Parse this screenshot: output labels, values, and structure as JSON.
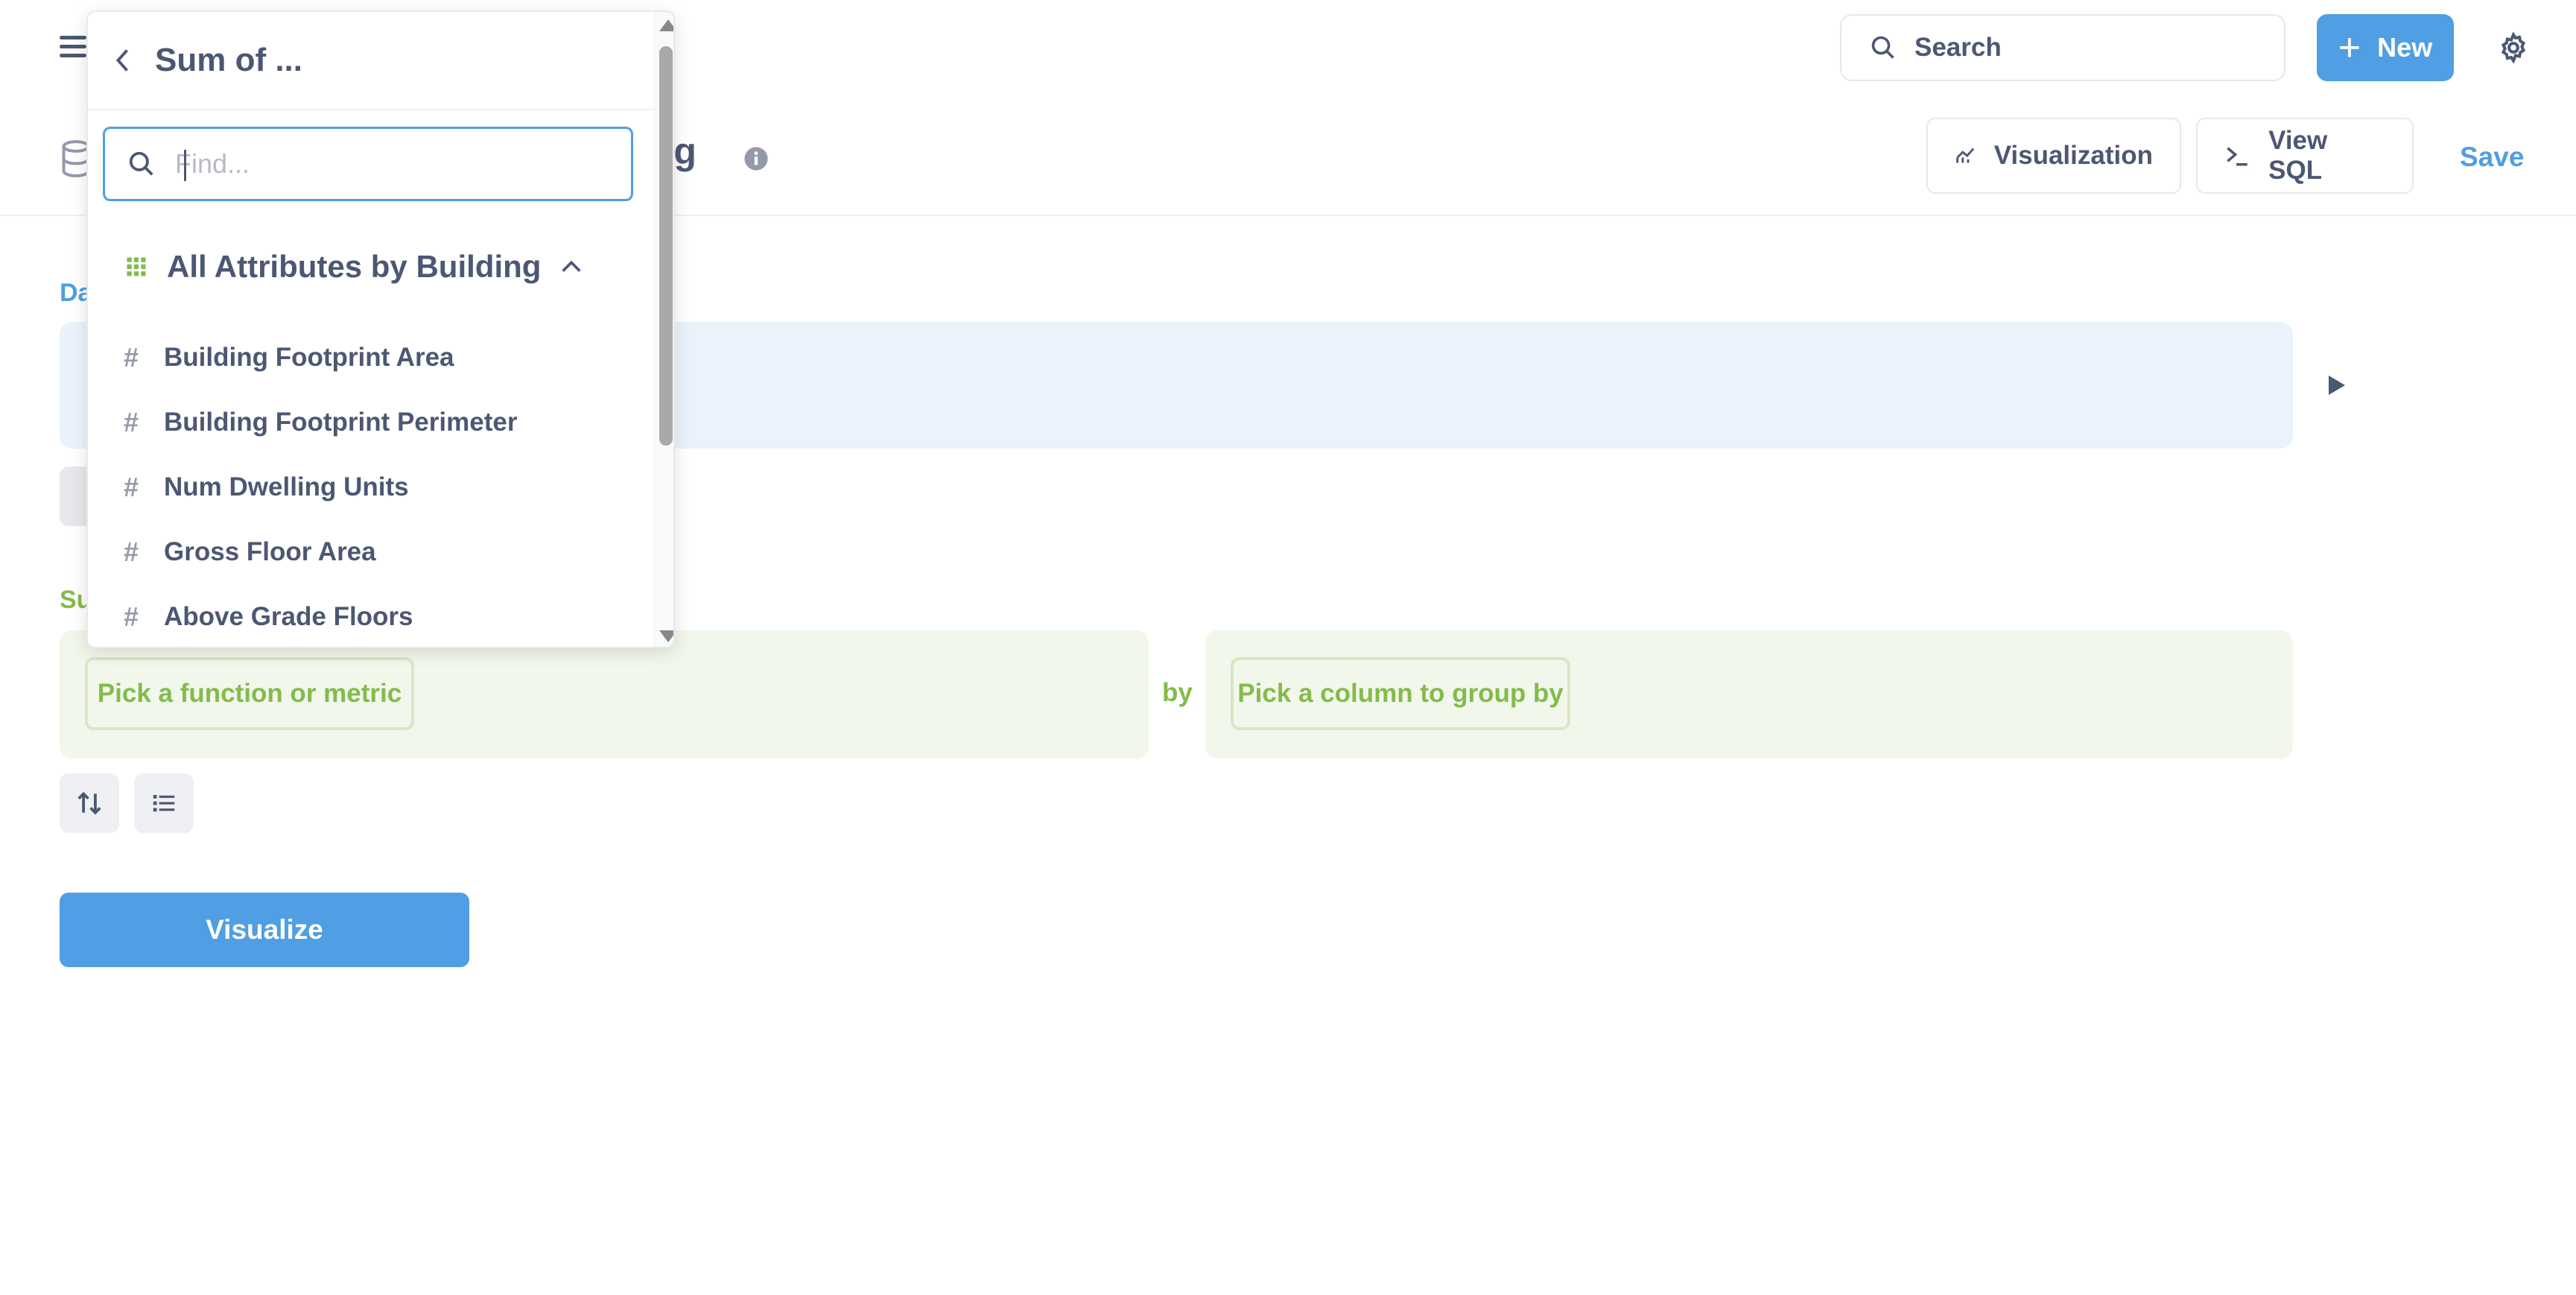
{
  "header": {
    "search_label": "Search",
    "new_label": "New",
    "title_fragment": "ing"
  },
  "toolbar": {
    "visualization_label": "Visualization",
    "view_sql_label": "View SQL",
    "save_label": "Save"
  },
  "sections": {
    "data_label_fragment": "Da",
    "summarize_label_fragment": "Su"
  },
  "summarize": {
    "pick_function_label": "Pick a function or metric",
    "by_label": "by",
    "pick_column_label": "Pick a column to group by"
  },
  "visualize_label": "Visualize",
  "popover": {
    "title": "Sum of ...",
    "find_placeholder": "Find...",
    "table_name": "All Attributes by Building",
    "fields": [
      {
        "label": "Building Footprint Area"
      },
      {
        "label": "Building Footprint Perimeter"
      },
      {
        "label": "Num Dwelling Units"
      },
      {
        "label": "Gross Floor Area"
      },
      {
        "label": "Above Grade Floors"
      }
    ]
  },
  "colors": {
    "brand": "#509ee3",
    "summarize_green": "#84bb4c",
    "text": "#4c5773"
  }
}
